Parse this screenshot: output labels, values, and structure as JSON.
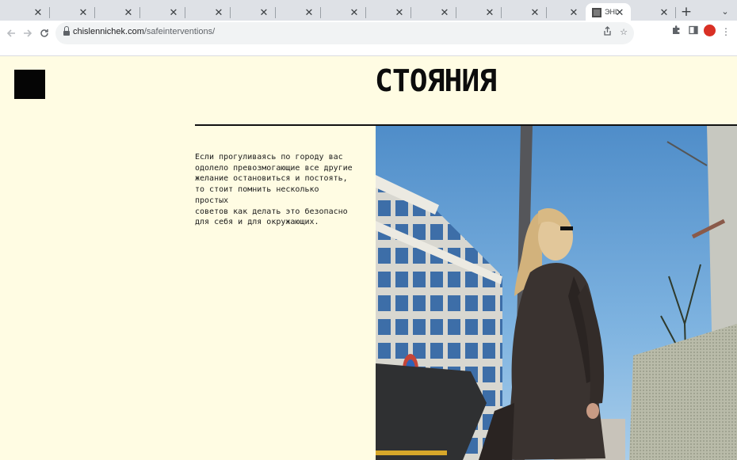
{
  "browser": {
    "tabs": [
      {
        "close": "✕"
      },
      {
        "close": "✕"
      },
      {
        "close": "✕"
      },
      {
        "close": "✕"
      },
      {
        "close": "✕"
      },
      {
        "close": "✕"
      },
      {
        "close": "✕"
      },
      {
        "close": "✕"
      },
      {
        "close": "✕"
      },
      {
        "close": "✕"
      },
      {
        "close": "✕"
      },
      {
        "close": "✕"
      },
      {
        "title": "ЭНЦ",
        "close": "✕",
        "active": true
      },
      {
        "close": "✕"
      }
    ],
    "new_tab": "+",
    "tab_search": "⌄",
    "url_host": "chislennichek.com",
    "url_path": "/safeinterventions/",
    "icons": {
      "back": "arrow-left-icon",
      "forward": "arrow-right-icon",
      "reload": "reload-icon",
      "lock": "lock-icon",
      "share": "share-icon",
      "bookmark": "star-icon",
      "extensions": "puzzle-icon",
      "side_panel": "side-panel-icon",
      "menu": "kebab-menu-icon"
    },
    "profile_color": "#d93025"
  },
  "page": {
    "heading": "СТОЯНИЯ",
    "intro": "Если прогуливаясь по городу вас\nодолело превозмогающие все другие\nжелание остановиться и постоять,\nто стоит помнить несколько простых\nсоветов как делать это безопасно\nдля себя и для окружающих.",
    "background": "#fffce3"
  }
}
